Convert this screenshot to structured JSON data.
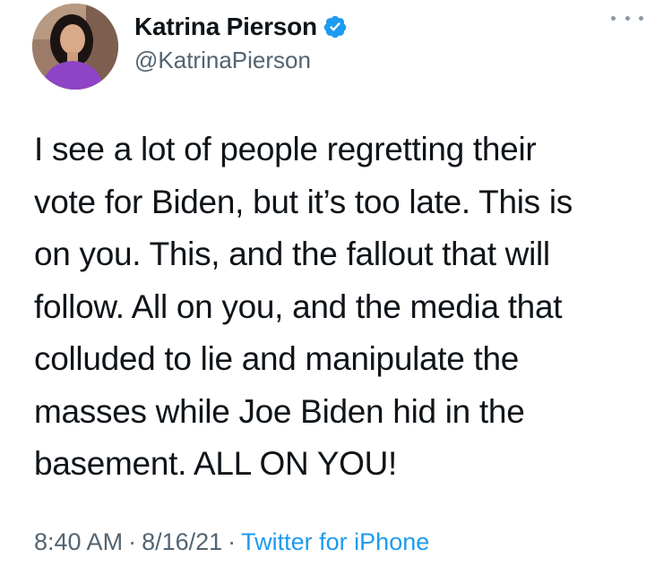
{
  "author": {
    "display_name": "Katrina Pierson",
    "handle": "@KatrinaPierson",
    "verified": true,
    "avatar_icon": "profile-photo",
    "verified_icon": "verified-badge-icon"
  },
  "menu": {
    "icon": "more-options-icon"
  },
  "tweet": {
    "lines": [
      "I see a lot of people regretting their",
      "vote for Biden, but it’s too late. This is",
      "on you. This, and the fallout that will",
      "follow. All on you, and the media that",
      "colluded to lie and manipulate the",
      "masses while Joe Biden hid in the",
      "basement. ALL ON YOU!"
    ]
  },
  "meta": {
    "time": "8:40 AM",
    "separator": "·",
    "date": "8/16/21",
    "source": "Twitter for iPhone"
  },
  "colors": {
    "text": "#0f1419",
    "secondary": "#536471",
    "link": "#1d9bf0",
    "verified": "#1d9bf0"
  }
}
